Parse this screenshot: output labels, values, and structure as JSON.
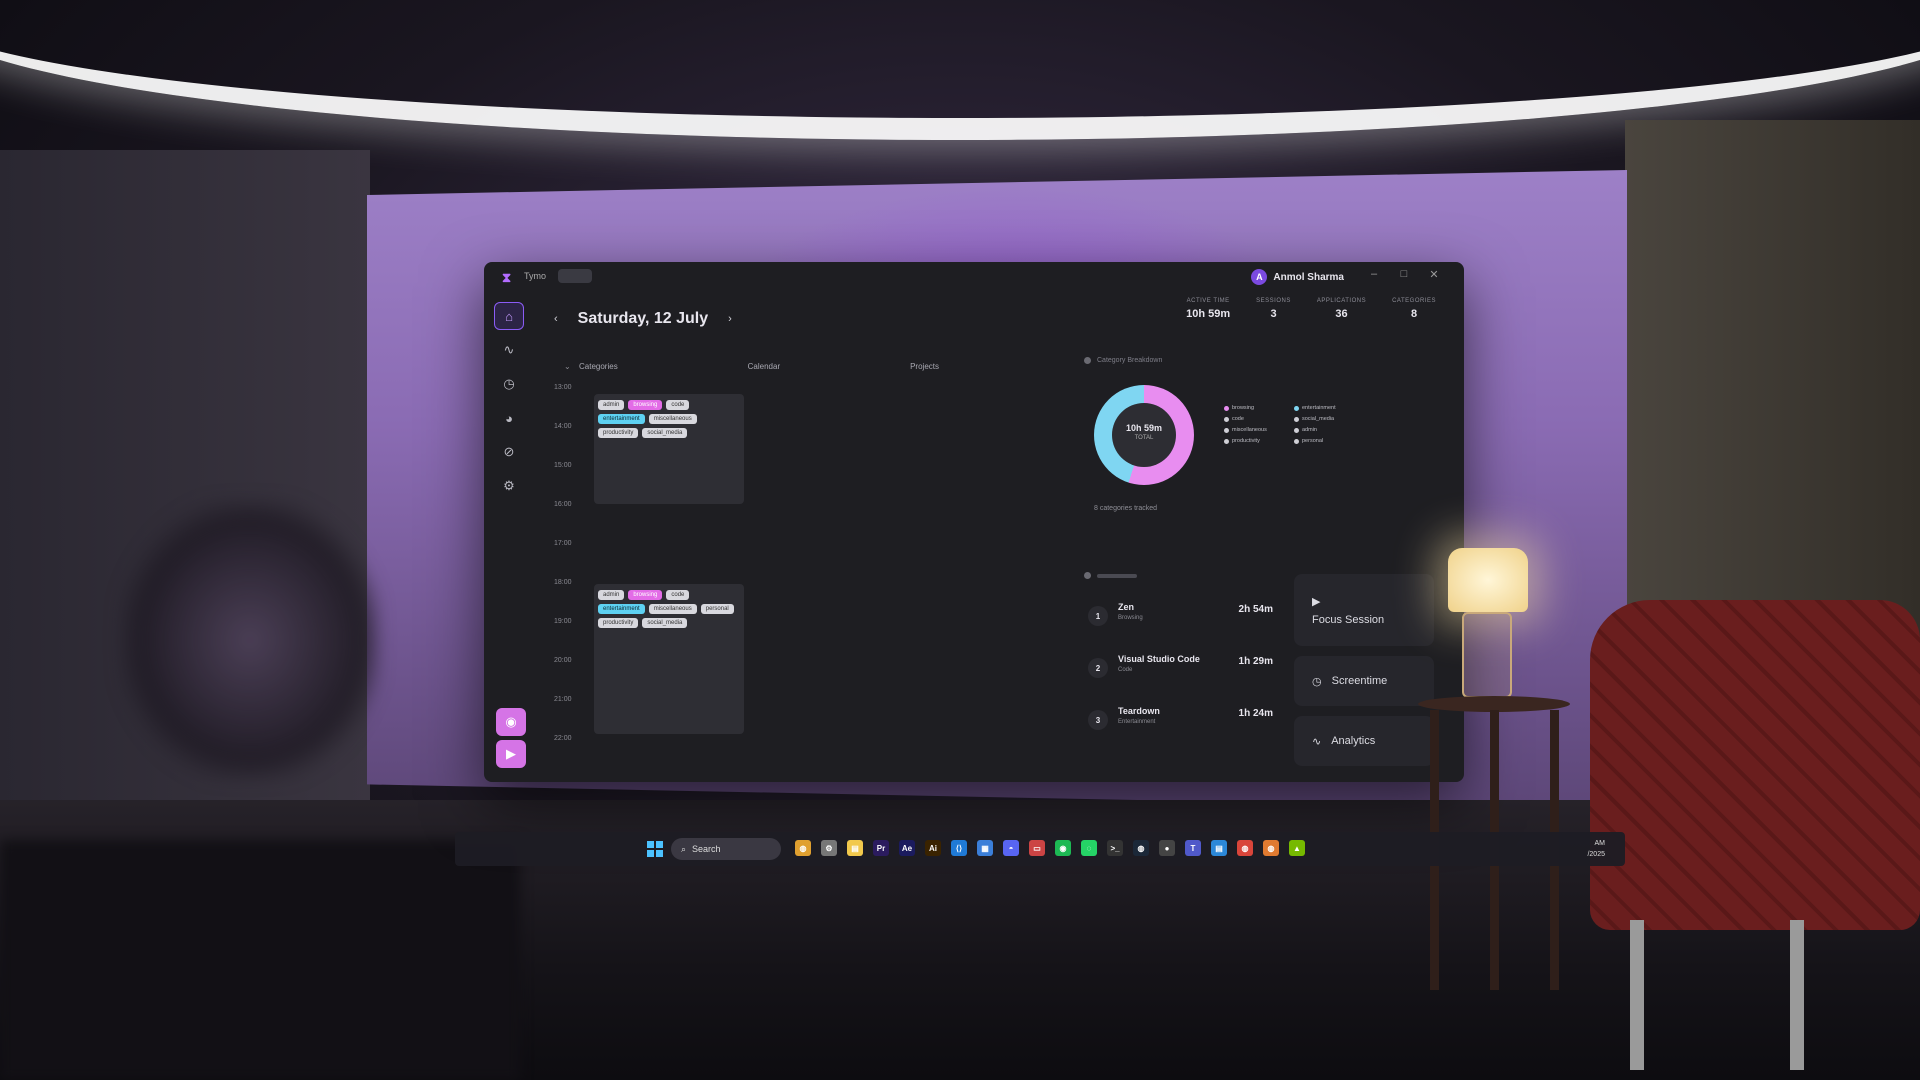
{
  "window": {
    "app_name": "Tymo",
    "user_initial": "A",
    "user_name": "Anmol Sharma"
  },
  "sidebar": {
    "items": [
      {
        "icon": "home-icon",
        "glyph": "⌂"
      },
      {
        "icon": "trend-icon",
        "glyph": "∿"
      },
      {
        "icon": "clock-icon",
        "glyph": "◷"
      },
      {
        "icon": "pie-icon",
        "glyph": "◕"
      },
      {
        "icon": "block-icon",
        "glyph": "⊘"
      },
      {
        "icon": "settings-icon",
        "glyph": "⚙"
      }
    ],
    "bottom": [
      {
        "icon": "eye-icon",
        "glyph": "◉"
      },
      {
        "icon": "play-icon",
        "glyph": "▶"
      }
    ]
  },
  "header": {
    "prev": "‹",
    "next": "›",
    "date": "Saturday, 12 July"
  },
  "stats": [
    {
      "label": "ACTIVE TIME",
      "value": "10h 59m"
    },
    {
      "label": "SESSIONS",
      "value": "3"
    },
    {
      "label": "APPLICATIONS",
      "value": "36"
    },
    {
      "label": "CATEGORIES",
      "value": "8"
    }
  ],
  "tabs": [
    "Categories",
    "Calendar",
    "Projects"
  ],
  "timeline": {
    "ticks": [
      "13:00",
      "14:00",
      "15:00",
      "16:00",
      "17:00",
      "18:00",
      "19:00",
      "20:00",
      "21:00",
      "22:00"
    ],
    "blocks": [
      {
        "tags": [
          {
            "t": "admin",
            "c": ""
          },
          {
            "t": "browsing",
            "c": "pink"
          },
          {
            "t": "code",
            "c": ""
          },
          {
            "t": "entertainment",
            "c": "cyan"
          },
          {
            "t": "miscellaneous",
            "c": ""
          },
          {
            "t": "productivity",
            "c": ""
          },
          {
            "t": "social_media",
            "c": ""
          }
        ]
      },
      {
        "tags": [
          {
            "t": "admin",
            "c": ""
          },
          {
            "t": "browsing",
            "c": "pink"
          },
          {
            "t": "code",
            "c": ""
          },
          {
            "t": "entertainment",
            "c": "cyan"
          },
          {
            "t": "miscellaneous",
            "c": ""
          },
          {
            "t": "personal",
            "c": ""
          },
          {
            "t": "productivity",
            "c": ""
          },
          {
            "t": "social_media",
            "c": ""
          }
        ]
      }
    ]
  },
  "donut": {
    "header": "Category Breakdown",
    "total": "10h 59m",
    "total_label": "TOTAL",
    "tracked": "8 categories tracked",
    "colors": {
      "browsing": "#e88df0",
      "entertainment": "#7fd6f2"
    },
    "legend": [
      {
        "name": "browsing",
        "color": "#e88df0"
      },
      {
        "name": "entertainment",
        "color": "#7fd6f2"
      },
      {
        "name": "code",
        "color": "#cfcfd6"
      },
      {
        "name": "social_media",
        "color": "#cfcfd6"
      },
      {
        "name": "miscellaneous",
        "color": "#cfcfd6"
      },
      {
        "name": "admin",
        "color": "#cfcfd6"
      },
      {
        "name": "productivity",
        "color": "#cfcfd6"
      },
      {
        "name": "personal",
        "color": "#cfcfd6"
      }
    ]
  },
  "apps": [
    {
      "rank": "1",
      "name": "Zen",
      "category": "Browsing",
      "time": "2h 54m"
    },
    {
      "rank": "2",
      "name": "Visual Studio Code",
      "category": "Code",
      "time": "1h 29m"
    },
    {
      "rank": "3",
      "name": "Teardown",
      "category": "Entertainment",
      "time": "1h 24m"
    }
  ],
  "actions": {
    "focus": "Focus Session",
    "screentime": "Screentime",
    "analytics": "Analytics"
  },
  "taskbar": {
    "search": "Search",
    "apps": [
      {
        "name": "chrome",
        "label": "◍",
        "color": "#e0a030"
      },
      {
        "name": "settings",
        "label": "⚙",
        "color": "#777"
      },
      {
        "name": "explorer",
        "label": "▤",
        "color": "#f2c94c"
      },
      {
        "name": "premiere",
        "label": "Pr",
        "color": "#2b1b5e"
      },
      {
        "name": "aftereffects",
        "label": "Ae",
        "color": "#1b1b5e"
      },
      {
        "name": "illustrator",
        "label": "Ai",
        "color": "#3a2300"
      },
      {
        "name": "vscode",
        "label": "⟨⟩",
        "color": "#1f7ad6"
      },
      {
        "name": "store",
        "label": "▦",
        "color": "#3b7fd9"
      },
      {
        "name": "discord",
        "label": "◓",
        "color": "#5865f2"
      },
      {
        "name": "mail",
        "label": "▭",
        "color": "#c44"
      },
      {
        "name": "spotify",
        "label": "◉",
        "color": "#1db954"
      },
      {
        "name": "whatsapp",
        "label": "◌",
        "color": "#25d366"
      },
      {
        "name": "terminal",
        "label": ">_",
        "color": "#333"
      },
      {
        "name": "steam",
        "label": "◍",
        "color": "#1b2838"
      },
      {
        "name": "obs",
        "label": "●",
        "color": "#444"
      },
      {
        "name": "teams",
        "label": "T",
        "color": "#5059c9"
      },
      {
        "name": "files",
        "label": "▤",
        "color": "#2b88d8"
      },
      {
        "name": "chrome-2",
        "label": "◍",
        "color": "#d9453a"
      },
      {
        "name": "chrome-3",
        "label": "◍",
        "color": "#e07a30"
      },
      {
        "name": "nvidia",
        "label": "▲",
        "color": "#76b900"
      }
    ],
    "time": "AM",
    "date": "/2025"
  }
}
